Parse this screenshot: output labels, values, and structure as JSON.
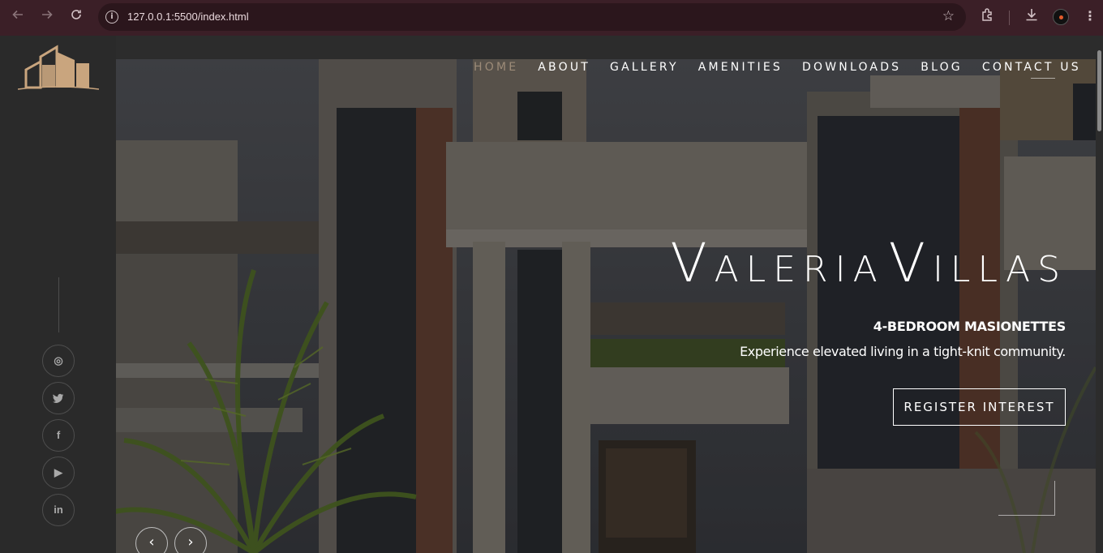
{
  "browser": {
    "back_icon": "arrow-left-icon",
    "forward_icon": "arrow-right-icon",
    "reload_icon": "reload-icon",
    "url": "127.0.0.1:5500/index.html",
    "bookmark_icon": "star-icon",
    "extensions_icon": "puzzle-icon",
    "download_icon": "download-icon",
    "menu_icon": "kebab-menu-icon",
    "colors": {
      "frame": "#3b1f27",
      "omnibox": "#2b161c"
    }
  },
  "site": {
    "logo_icon": "building-logo-icon",
    "accent": "#c9a57e",
    "nav": [
      {
        "label": "HOME",
        "active": true
      },
      {
        "label": "ABOUT",
        "active": false
      },
      {
        "label": "GALLERY",
        "active": false
      },
      {
        "label": "AMENITIES",
        "active": false
      },
      {
        "label": "DOWNLOADS",
        "active": false
      },
      {
        "label": "BLOG",
        "active": false
      },
      {
        "label": "CONTACT US",
        "active": false
      }
    ],
    "social": [
      {
        "icon": "instagram-icon",
        "glyph": "◎"
      },
      {
        "icon": "twitter-icon",
        "glyph": "🐦"
      },
      {
        "icon": "facebook-icon",
        "glyph": "f"
      },
      {
        "icon": "youtube-icon",
        "glyph": "▶"
      },
      {
        "icon": "linkedin-icon",
        "glyph": "in"
      }
    ]
  },
  "hero": {
    "title": "Valeria Villas",
    "subtitle": "4-BEDROOM MASIONETTES",
    "tagline": "Experience elevated living in a tight-knit community.",
    "cta_label": "REGISTER INTEREST",
    "prev_icon": "chevron-left-icon",
    "next_icon": "chevron-right-icon"
  }
}
